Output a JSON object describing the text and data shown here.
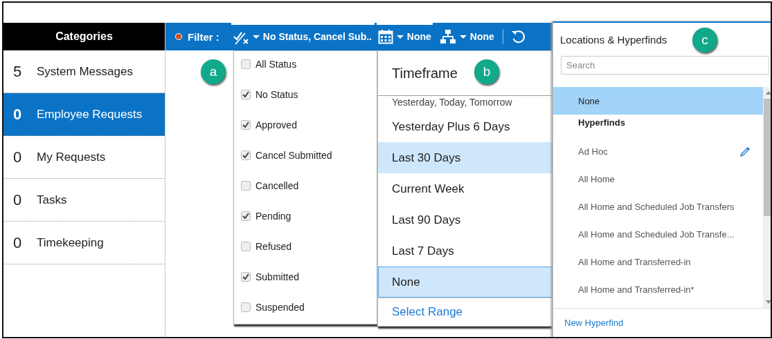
{
  "sidebar": {
    "title": "Categories",
    "items": [
      {
        "count": "5",
        "label": "System Messages",
        "selected": false
      },
      {
        "count": "0",
        "label": "Employee Requests",
        "selected": true
      },
      {
        "count": "0",
        "label": "My Requests",
        "selected": false
      },
      {
        "count": "0",
        "label": "Tasks",
        "selected": false
      },
      {
        "count": "0",
        "label": "Timekeeping",
        "selected": false
      }
    ]
  },
  "toolbar": {
    "filter_label": "Filter :",
    "status_filter": {
      "text": "No Status, Cancel Sub..",
      "open": true
    },
    "timeframe_filter": {
      "text": "None",
      "open": true
    },
    "hierarchy_filter": {
      "text": "None",
      "open": false
    }
  },
  "status_menu": {
    "items": [
      {
        "label": "All Status",
        "checked": false
      },
      {
        "label": "No Status",
        "checked": true
      },
      {
        "label": "Approved",
        "checked": true
      },
      {
        "label": "Cancel Submitted",
        "checked": true
      },
      {
        "label": "Cancelled",
        "checked": false
      },
      {
        "label": "Pending",
        "checked": true
      },
      {
        "label": "Refused",
        "checked": false
      },
      {
        "label": "Submitted",
        "checked": true
      },
      {
        "label": "Suspended",
        "checked": false
      }
    ]
  },
  "timeframe_menu": {
    "title": "Timeframe",
    "items": [
      {
        "label": "Yesterday, Today, Tomorrow",
        "selected": false,
        "hovered": false
      },
      {
        "label": "Yesterday Plus 6 Days",
        "selected": false,
        "hovered": false
      },
      {
        "label": "Last 30 Days",
        "selected": false,
        "hovered": true
      },
      {
        "label": "Current Week",
        "selected": false,
        "hovered": false
      },
      {
        "label": "Last 90 Days",
        "selected": false,
        "hovered": false
      },
      {
        "label": "Last 7 Days",
        "selected": false,
        "hovered": false
      },
      {
        "label": "None",
        "selected": true,
        "hovered": false
      }
    ],
    "link": "Select Range"
  },
  "locations_panel": {
    "title": "Locations & Hyperfinds",
    "search": {
      "placeholder": "Search"
    },
    "items": [
      {
        "kind": "option",
        "label": "None",
        "selected": true,
        "editable": false
      },
      {
        "kind": "header",
        "label": "Hyperfinds"
      },
      {
        "kind": "option",
        "label": "Ad Hoc",
        "selected": false,
        "editable": true
      },
      {
        "kind": "option",
        "label": "All Home",
        "selected": false,
        "editable": false
      },
      {
        "kind": "option",
        "label": "All Home and Scheduled Job Transfers",
        "selected": false,
        "editable": false
      },
      {
        "kind": "option",
        "label": "All Home and Scheduled Job Transfe...",
        "selected": false,
        "editable": false
      },
      {
        "kind": "option",
        "label": "All Home and Transferred-in",
        "selected": false,
        "editable": false
      },
      {
        "kind": "option",
        "label": "All Home and Transferred-in*",
        "selected": false,
        "editable": false
      }
    ],
    "footer_link": "New Hyperfind"
  },
  "callouts": [
    {
      "label": "a"
    },
    {
      "label": "b"
    },
    {
      "label": "c"
    }
  ]
}
